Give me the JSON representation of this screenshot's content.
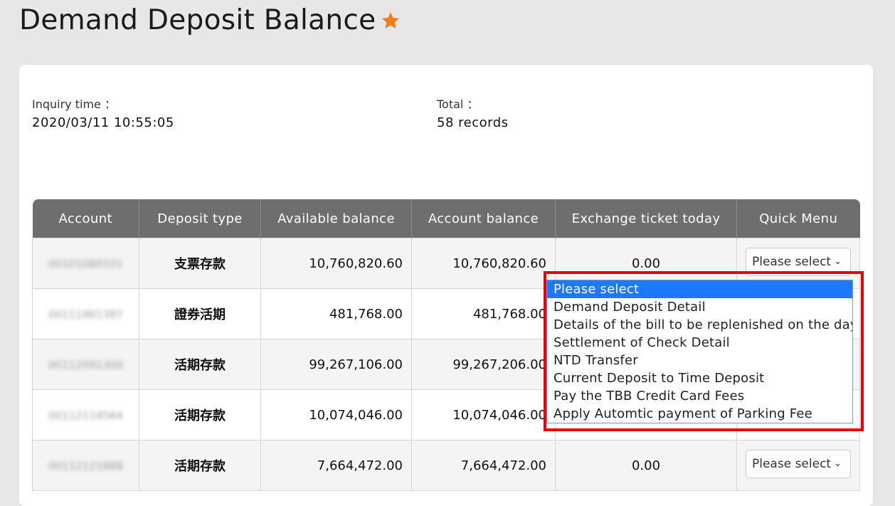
{
  "page": {
    "title": "Demand Deposit Balance",
    "star_color": "#f07d1b"
  },
  "info": {
    "inquiry_label": "Inquiry time ：",
    "inquiry_value": "2020/03/11 10:55:05",
    "total_label": "Total ：",
    "total_value": "58 records"
  },
  "table": {
    "headers": [
      "Account",
      "Deposit type",
      "Available balance",
      "Account balance",
      "Exchange ticket today",
      "Quick Menu"
    ],
    "rows": [
      {
        "account": "00101080331",
        "type": "支票存款",
        "available": "10,760,820.60",
        "balance": "10,760,820.60",
        "exchange": "0.00",
        "menu": "Please select"
      },
      {
        "account": "00111961387",
        "type": "證券活期",
        "available": "481,768.00",
        "balance": "481,768.00",
        "exchange": "",
        "menu": ""
      },
      {
        "account": "00112091300",
        "type": "活期存款",
        "available": "99,267,106.00",
        "balance": "99,267,206.00",
        "exchange": "",
        "menu": ""
      },
      {
        "account": "00112114564",
        "type": "活期存款",
        "available": "10,074,046.00",
        "balance": "10,074,046.00",
        "exchange": "",
        "menu": ""
      },
      {
        "account": "00112121888",
        "type": "活期存款",
        "available": "7,664,472.00",
        "balance": "7,664,472.00",
        "exchange": "0.00",
        "menu": "Please select"
      }
    ]
  },
  "dropdown": {
    "options": [
      "Please select",
      "Demand Deposit Detail",
      "Details of the bill to be replenished on the day",
      "Settlement of Check Detail",
      "NTD Transfer",
      "Current Deposit to Time Deposit",
      "Pay the TBB Credit Card Fees",
      "Apply Automtic payment of Parking Fee"
    ],
    "selected_index": 0,
    "highlight_color": "#e8000b"
  }
}
